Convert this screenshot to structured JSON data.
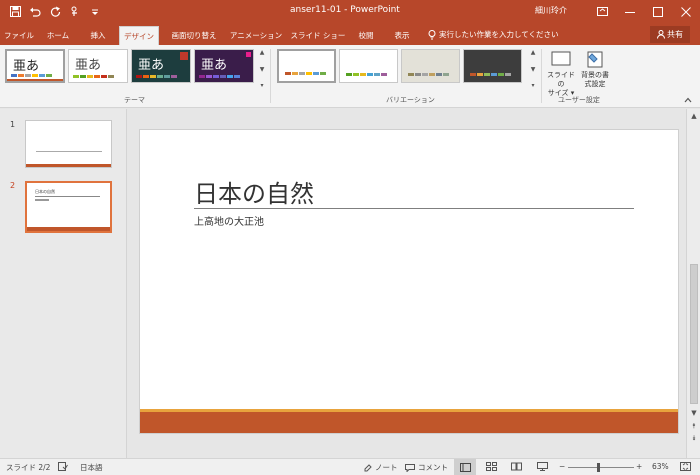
{
  "colors": {
    "accent": "#b7472a",
    "slide_band": "#c0562a",
    "slide_band_top": "#e8a33d",
    "thumb_selected": "#e0733d"
  },
  "window": {
    "title": "anser11-01  -  PowerPoint",
    "user": "細川玲介",
    "qat_icons": [
      "save-icon",
      "undo-icon",
      "redo-icon",
      "touch-mode-icon",
      "customize-qat-icon"
    ]
  },
  "tabs": [
    "ファイル",
    "ホーム",
    "挿入",
    "デザイン",
    "画面切り替え",
    "アニメーション",
    "スライド ショー",
    "校閲",
    "表示"
  ],
  "active_tab": "デザイン",
  "tell_me": "実行したい作業を入力してください",
  "share_label": "共有",
  "ribbon": {
    "theme_glyph": "亜あ",
    "themes_label": "テーマ",
    "variations_label": "バリエーション",
    "customize_label": "ユーザー設定",
    "slide_size_label": [
      "スライドの",
      "サイズ ▾"
    ],
    "format_bg_label": [
      "背景の書",
      "式設定"
    ]
  },
  "slides": [
    {
      "number": "1"
    },
    {
      "number": "2",
      "mini_title": "日本の自然"
    }
  ],
  "slide": {
    "title": "日本の自然",
    "subtitle": "上高地の大正池"
  },
  "status": {
    "slide_info": "スライド 2/2",
    "language": "日本語",
    "notes": "ノート",
    "comments": "コメント",
    "zoom": "63%"
  }
}
